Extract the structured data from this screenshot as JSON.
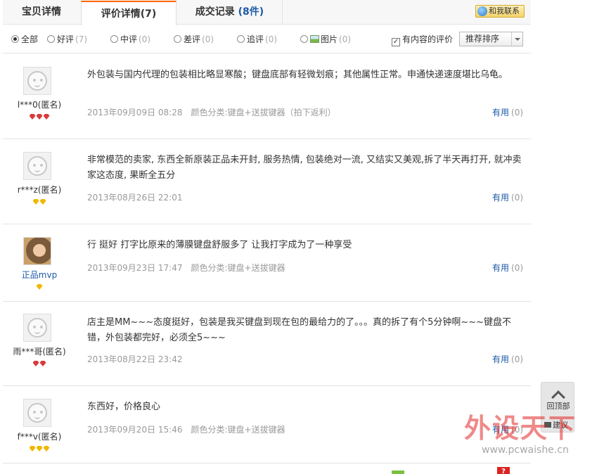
{
  "tabs": [
    {
      "label": "宝贝详情"
    },
    {
      "label": "评价详情",
      "count": "(7)"
    },
    {
      "label": "成交记录",
      "count": "(8件)"
    }
  ],
  "contact_label": "和我联系",
  "filters": [
    {
      "label": "全部",
      "count": ""
    },
    {
      "label": "好评",
      "count": "(7)"
    },
    {
      "label": "中评",
      "count": "(0)"
    },
    {
      "label": "差评",
      "count": "(0)"
    },
    {
      "label": "追评",
      "count": "(0)"
    },
    {
      "label": "图片",
      "count": "(0)"
    }
  ],
  "content_filter_label": "有内容的评价",
  "sort_label": "推荐排序",
  "useful_label": "有用",
  "reviews": [
    {
      "user": "l***0(匿名)",
      "badge": "red",
      "badge_count": 3,
      "text": "外包装与国内代理的包装相比略显寒酸；键盘底部有轻微划痕；其他属性正常。申通快递速度堪比乌龟。",
      "date": "2013年09月09日 08:28",
      "attr": "颜色分类:键盘+送拔键器（拍下返利）",
      "useful": "(0)"
    },
    {
      "user": "r***z(匿名)",
      "badge": "gold",
      "badge_count": 2,
      "text": "非常模范的卖家, 东西全新原装正品未开封, 服务热情, 包装绝对一流, 又结实又美观,拆了半天再打开, 就冲卖家这态度, 果断全五分",
      "date": "2013年08月26日 22:01",
      "attr": "",
      "useful": "(0)"
    },
    {
      "user": "正品mvp",
      "badge": "gold",
      "badge_count": 1,
      "text": "行 挺好 打字比原来的薄膜键盘舒服多了 让我打字成为了一种享受",
      "date": "2013年09月23日 17:47",
      "attr": "颜色分类:键盘+送拔键器",
      "useful": "(0)"
    },
    {
      "user": "雨***哥(匿名)",
      "badge": "red",
      "badge_count": 2,
      "text": "店主是MM~~~态度挺好，包装是我买键盘到现在包的最给力的了。。。真的拆了有个5分钟啊~~~键盘不错，外包装都完好，必须全5~~~",
      "date": "2013年08月22日 23:42",
      "attr": "",
      "useful": "(0)"
    },
    {
      "user": "f***v(匿名)",
      "badge": "gold",
      "badge_count": 3,
      "text": "东西好，价格良心",
      "date": "2013年09月20日 15:46",
      "attr": "颜色分类:键盘+送拔键器",
      "useful": "(0)"
    }
  ],
  "side": {
    "top_label": "回顶部",
    "suggest_label": "建议"
  },
  "watermark": {
    "text": "外设天下",
    "url": "www.pcwaishe.cn"
  }
}
